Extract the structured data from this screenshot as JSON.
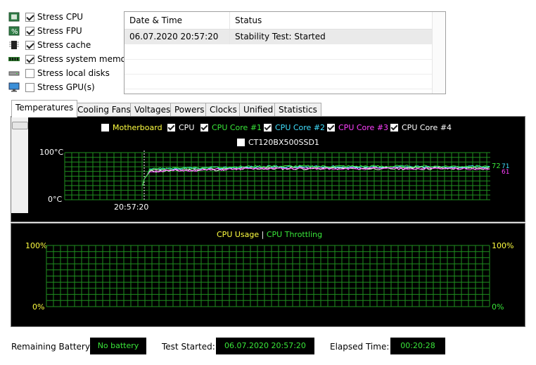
{
  "stress_options": [
    {
      "label": "Stress CPU",
      "checked": true,
      "icon": "cpu-icon"
    },
    {
      "label": "Stress FPU",
      "checked": true,
      "icon": "fpu-icon"
    },
    {
      "label": "Stress cache",
      "checked": true,
      "icon": "cache-icon"
    },
    {
      "label": "Stress system memory",
      "checked": true,
      "icon": "memory-icon"
    },
    {
      "label": "Stress local disks",
      "checked": false,
      "icon": "disk-icon"
    },
    {
      "label": "Stress GPU(s)",
      "checked": false,
      "icon": "monitor-icon"
    }
  ],
  "log": {
    "columns": [
      "Date & Time",
      "Status"
    ],
    "rows": [
      {
        "datetime": "06.07.2020 20:57:20",
        "status": "Stability Test: Started"
      }
    ]
  },
  "tabs": [
    "Temperatures",
    "Cooling Fans",
    "Voltages",
    "Powers",
    "Clocks",
    "Unified",
    "Statistics"
  ],
  "active_tab": "Temperatures",
  "temp_chart": {
    "legend": [
      {
        "label": "Motherboard",
        "checked": false,
        "color": "#ffff40"
      },
      {
        "label": "CPU",
        "checked": true,
        "color": "#ffffff"
      },
      {
        "label": "CPU Core #1",
        "checked": true,
        "color": "#39e639"
      },
      {
        "label": "CPU Core #2",
        "checked": true,
        "color": "#40e0ff"
      },
      {
        "label": "CPU Core #3",
        "checked": true,
        "color": "#ff40ff"
      },
      {
        "label": "CPU Core #4",
        "checked": true,
        "color": "#ffffff"
      },
      {
        "label": "CT120BX500SSD1",
        "checked": false,
        "color": "#ffffff"
      }
    ],
    "y_top_label": "100°C",
    "y_bottom_label": "0°C",
    "x_label": "20:57:20",
    "end_values": [
      {
        "text": "72",
        "color": "#39e639"
      },
      {
        "text": "71",
        "color": "#40e0ff"
      },
      {
        "text": "61",
        "color": "#ff40ff"
      }
    ],
    "grid_color": "#1f8f1f"
  },
  "cpu_chart": {
    "title_usage": "CPU Usage",
    "separator": "|",
    "title_throttling": "CPU Throttling",
    "usage_color": "#ffff40",
    "throttle_color": "#39e639",
    "left_top": "100%",
    "left_bottom": "0%",
    "right_top": "100%",
    "right_bottom": "0%"
  },
  "status_bar": {
    "battery_label": "Remaining Battery:",
    "battery_value": "No battery",
    "started_label": "Test Started:",
    "started_value": "06.07.2020 20:57:20",
    "elapsed_label": "Elapsed Time:",
    "elapsed_value": "00:20:28"
  }
}
